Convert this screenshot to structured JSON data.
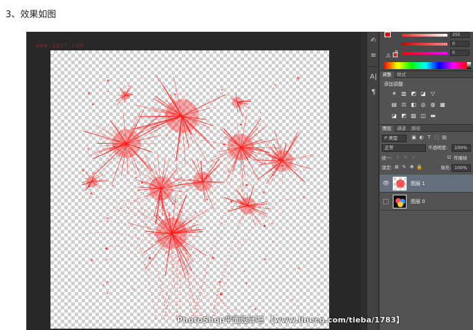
{
  "heading": "3、效果如图",
  "watermark_top": "WWW.58ST.COM",
  "watermark_bottom": "PhotoShop平面设计吧 【www.linecg.com/tieba/1783】",
  "colors": {
    "canvas_bg": "#282828",
    "panel_bg": "#535353",
    "selected_layer": "#65707f",
    "firework_red": "#ff1a1a"
  },
  "tools": [
    "pen-brush-icon",
    "adjust-icon",
    "character-icon",
    "paragraph-icon"
  ],
  "tool_glyphs": [
    "✍",
    "≡",
    "A|",
    "¶"
  ],
  "color_panel": {
    "slider_top_value": "255",
    "slider_b_label": "B",
    "slider_b_value": "0",
    "slider_mid_value": "0"
  },
  "adjustments": {
    "tabs": [
      "调整",
      "样式"
    ],
    "title": "添加调整",
    "row1": [
      "☀",
      "▥",
      "◩",
      "◪",
      "▽"
    ],
    "row2": [
      "▤",
      "⚖",
      "◧",
      "◎",
      "◍",
      "▦"
    ],
    "row3": [
      "◪",
      "◩",
      "▨",
      "◫",
      "▬"
    ]
  },
  "layers": {
    "tabs": [
      "图层",
      "通道",
      "路径"
    ],
    "filter_label": "P 类型",
    "blend_mode": "正常",
    "opacity_label": "不透明度:",
    "opacity_value": "100%",
    "unify_label": "统一:",
    "propagate_label": "传播帧",
    "lock_label": "锁定:",
    "fill_label": "填充:",
    "fill_value": "100%",
    "items": [
      {
        "name": "图层 1",
        "visible": true,
        "selected": true
      },
      {
        "name": "图层 0",
        "visible": false,
        "selected": false
      }
    ]
  }
}
